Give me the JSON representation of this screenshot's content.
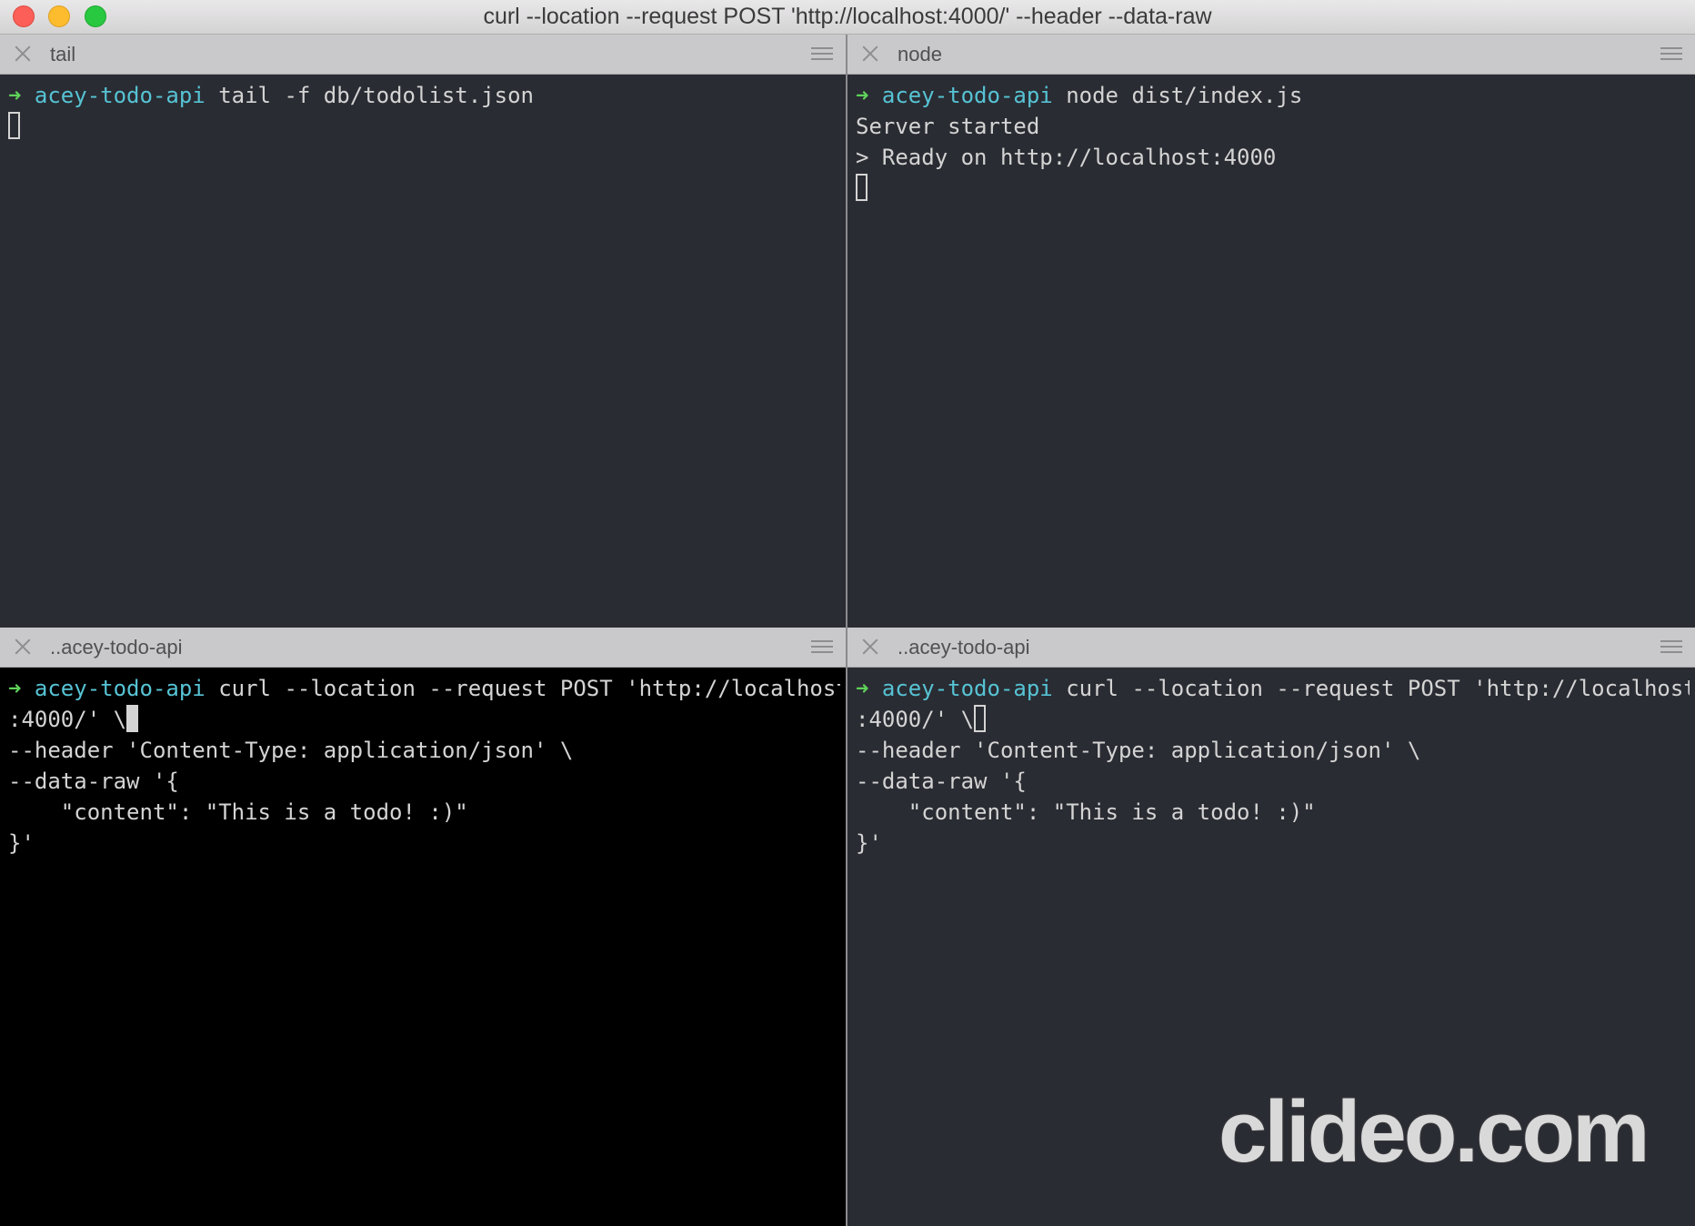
{
  "window": {
    "title": "curl --location --request POST 'http://localhost:4000/' --header  --data-raw"
  },
  "panes": {
    "top_left": {
      "tab_label": "tail",
      "prompt": {
        "arrow": "➜",
        "cwd": "acey-todo-api",
        "command": " tail -f db/todolist.json"
      }
    },
    "top_right": {
      "tab_label": "node",
      "prompt": {
        "arrow": "➜",
        "cwd": "acey-todo-api",
        "command": " node dist/index.js"
      },
      "output": [
        "Server started",
        "> Ready on http://localhost:4000"
      ]
    },
    "bottom_left": {
      "tab_label": "..acey-todo-api",
      "prompt": {
        "arrow": "➜",
        "cwd": "acey-todo-api",
        "command": " curl --location --request POST 'http://localhost"
      },
      "continuation": [
        ":4000/' \\",
        "--header 'Content-Type: application/json' \\",
        "--data-raw '{",
        "    \"content\": \"This is a todo! :)\"",
        "}'"
      ]
    },
    "bottom_right": {
      "tab_label": "..acey-todo-api",
      "prompt": {
        "arrow": "➜",
        "cwd": "acey-todo-api",
        "command": " curl --location --request POST 'http://localhost"
      },
      "continuation": [
        ":4000/' \\",
        "--header 'Content-Type: application/json' \\",
        "--data-raw '{",
        "    \"content\": \"This is a todo! :)\"",
        "}'"
      ]
    }
  },
  "watermark": "clideo.com",
  "colors": {
    "prompt_arrow": "#5fd35a",
    "prompt_cwd": "#56c3d4",
    "terminal_bg": "#2a2c33",
    "active_terminal_bg": "#000000"
  }
}
